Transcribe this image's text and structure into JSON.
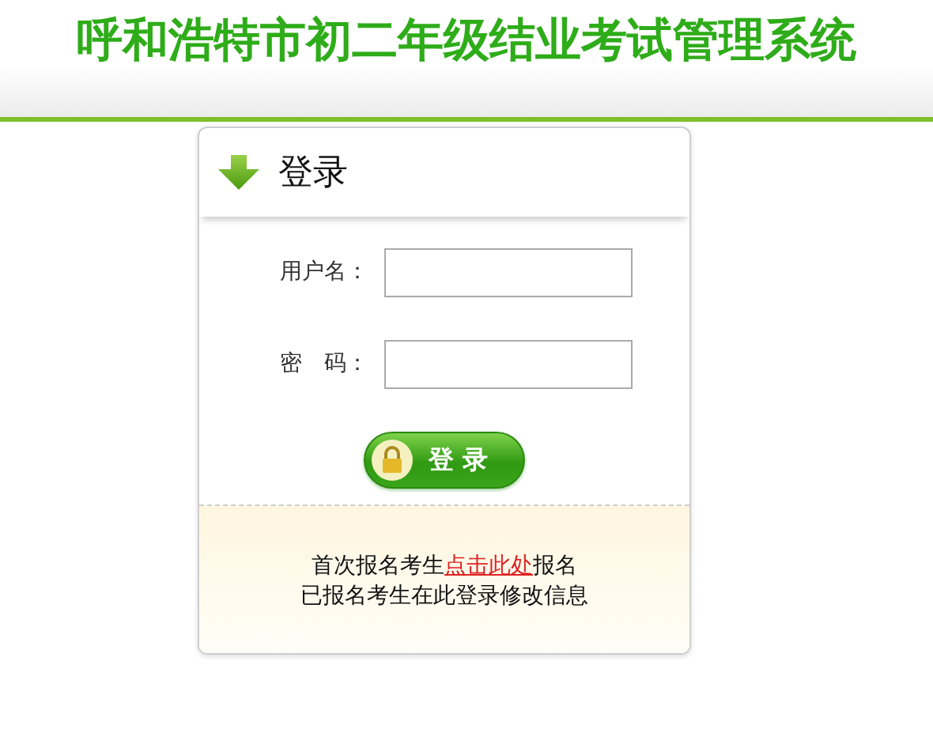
{
  "header": {
    "title": "呼和浩特市初二年级结业考试管理系统"
  },
  "login_panel": {
    "title": "登录",
    "fields": [
      {
        "label": "用户名："
      },
      {
        "label": "密　码："
      }
    ],
    "submit_button": "登 录",
    "notes": [
      {
        "before": "首次报名考生",
        "link": "点击此处",
        "after": "报名"
      },
      {
        "before": "已报名考生在此登录修改信息"
      }
    ]
  }
}
